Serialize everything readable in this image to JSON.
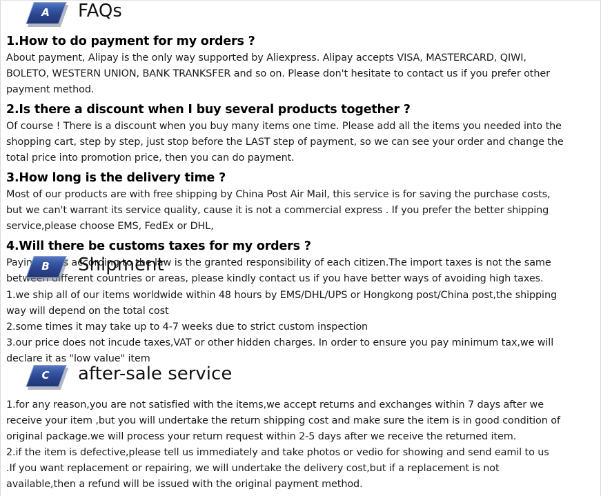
{
  "sections": [
    {
      "badge_letter": "A",
      "title": "FAQs",
      "items": [
        {
          "question": "1.How to do payment for my orders ?",
          "answer": "About payment, Alipay is the only way supported by Aliexpress. Alipay accepts VISA, MASTERCARD, QIWI, BOLETO, WESTERN UNION, BANK TRANKSFER and so on. Please don't hesitate to contact us if you prefer other payment method."
        },
        {
          "question": "2.Is there a discount when I buy several products together ?",
          "answer": "Of course ! There is a discount when you buy many items one time. Please add all the items you needed into the shopping cart, step by step, just stop before the LAST step of payment, so we can see your order and change the total price into promotion price, then you can do payment."
        },
        {
          "question": "3.How long is the delivery time ?",
          "answer": "Most of our products are with free shipping by China Post Air Mail, this service is for saving the purchase costs, but we can't warrant its service quality, cause it is not a commercial express . If you prefer the better shipping service,please choose EMS, FedEx or DHL,"
        },
        {
          "question": "4.Will there be customs taxes for my orders ?",
          "answer": "Paying taxes according to the law is the granted responsibility of each citizen.The import taxes is not the same between different countries or areas, please kindly contact us if you have better ways of avoiding high taxes."
        }
      ]
    },
    {
      "badge_letter": "B",
      "title": "Shipment",
      "lines": [
        "1.we ship all of our items worldwide within 48 hours by EMS/DHL/UPS or Hongkong post/China post,the shipping way will depend on the total cost",
        "2.some times it may take up to 4-7 weeks due to strict custom inspection",
        "3.our price does not incude taxes,VAT or other hidden charges. In order to ensure you pay minimum tax,we will declare it as \"low value\" item"
      ]
    },
    {
      "badge_letter": "C",
      "title": "after-sale service",
      "lines": [
        "1.for any reason,you are not satisfied with the items,we accept returns and exchanges within 7 days after we receive your item ,but you will undertake the return shipping cost and make sure the item is in good condition of original package.we will process your return request within 2-5 days after we receive the returned item.",
        "2.if the item is defective,please tell us immediately and take photos or vedio for showing and send eamil to us .If you want replacement or repairing, we will undertake the delivery cost,but if a replacement is not available,then a refund will be issued with the original payment method."
      ]
    }
  ],
  "colors": {
    "badge_dark": "#2b4490",
    "badge_light": "#5b78c0",
    "text": "#1a1a1a",
    "border": "#d8d8d8"
  }
}
